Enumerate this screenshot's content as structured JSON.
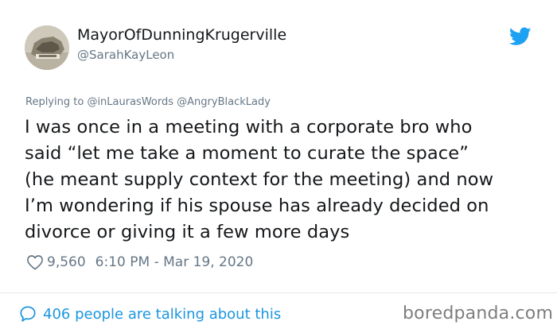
{
  "user": {
    "display_name": "MayorOfDunningKrugerville",
    "handle": "@SarahKayLeon"
  },
  "reply": {
    "prefix": "Replying to",
    "mentions": [
      "@inLaurasWords",
      "@AngryBlackLady"
    ]
  },
  "tweet": {
    "lines": [
      "I was once in a meeting with a corporate bro who",
      "said “let me take a moment to curate the space”",
      "(he meant supply context for the meeting) and now",
      "I’m wondering if his spouse has already decided on",
      "divorce or giving it a few more days"
    ]
  },
  "meta": {
    "likes": "9,560",
    "timestamp": "6:10 PM - Mar 19, 2020"
  },
  "footer": {
    "talking": "406 people are talking about this",
    "watermark": "boredpanda.com"
  },
  "icons": {
    "brand": "twitter-bird-icon",
    "like": "heart-icon",
    "conversation": "speech-bubble-icon"
  },
  "colors": {
    "twitter_blue": "#1da1f2",
    "link_blue": "#1b95e0",
    "text": "#14171a",
    "muted": "#657786",
    "divider": "#e1e8ed"
  }
}
